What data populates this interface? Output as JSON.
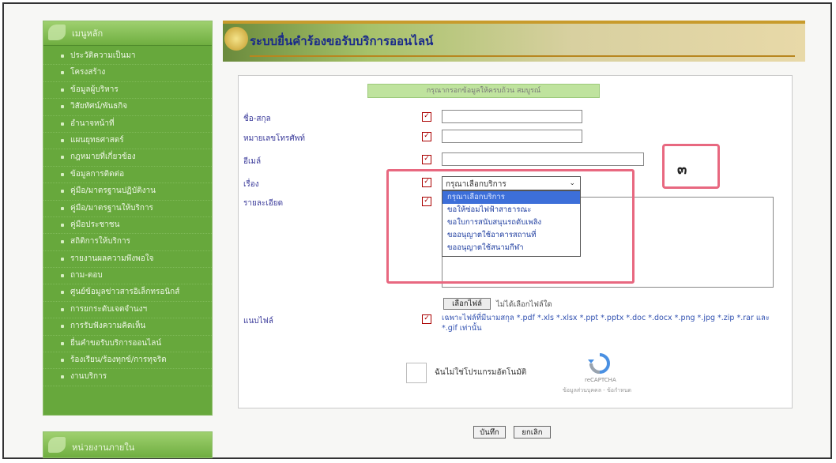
{
  "sidebar": {
    "heading": "เมนูหลัก",
    "items": [
      "ประวัติความเป็นมา",
      "โครงสร้าง",
      "ข้อมูลผู้บริหาร",
      "วิสัยทัศน์/พันธกิจ",
      "อำนาจหน้าที่",
      "แผนยุทธศาสตร์",
      "กฎหมายที่เกี่ยวข้อง",
      "ข้อมูลการติดต่อ",
      "คู่มือ/มาตรฐานปฏิบัติงาน",
      "คู่มือ/มาตรฐานให้บริการ",
      "คู่มือประชาชน",
      "สถิติการให้บริการ",
      "รายงานผลความพึงพอใจ",
      "ถาม-ตอบ",
      "ศูนย์ข้อมูลข่าวสารอิเล็กทรอนิกส์",
      "การยกระดับเจตจำนงฯ",
      "การรับฟังความคิดเห็น",
      "ยื่นคำขอรับบริการออนไลน์",
      "ร้องเรียน/ร้องทุกข์/การทุจริต",
      "งานบริการ"
    ],
    "second_heading": "หน่วยงานภายใน"
  },
  "banner": {
    "title": "ระบบยื่นคำร้องขอรับบริการออนไลน์"
  },
  "form": {
    "header": "กรุณากรอกข้อมูลให้ครบถ้วน สมบูรณ์",
    "name_label": "ชื่อ-สกุล",
    "phone_label": "หมายเลขโทรศัพท์",
    "email_label": "อีเมล์",
    "subject_label": "เรื่อง",
    "detail_label": "รายละเอียด",
    "attach_label": "แนบไฟล์",
    "select_value": "กรุณาเลือกบริการ",
    "options": [
      "กรุณาเลือกบริการ",
      "ขอให้ซ่อมไฟฟ้าสาธารณะ",
      "ขอใบการสนับสนุนรถดับเพลิง",
      "ขออนุญาตใช้อาคารสถานที่",
      "ขออนุญาตใช้สนามกีฬา"
    ],
    "file_button": "เลือกไฟล์",
    "file_status": "ไม่ได้เลือกไฟล์ใด",
    "file_note": "เฉพาะไฟล์ที่มีนามสกุล *.pdf *.xls *.xlsx *.ppt *.pptx *.doc *.docx *.png *.jpg *.zip *.rar และ *.gif เท่านั้น",
    "captcha_text": "ฉันไม่ใช่โปรแกรมอัตโนมัติ",
    "recaptcha_name": "reCAPTCHA",
    "recaptcha_links": "ข้อมูลส่วนบุคคล - ข้อกำหนด",
    "save_button": "บันทึก",
    "cancel_button": "ยกเลิก"
  },
  "annotation": {
    "marker": "๓"
  },
  "colors": {
    "sidebar": "#67a83c",
    "title": "#1a2a8a",
    "highlight": "#e86880",
    "selected_option": "#3d6fd9"
  }
}
